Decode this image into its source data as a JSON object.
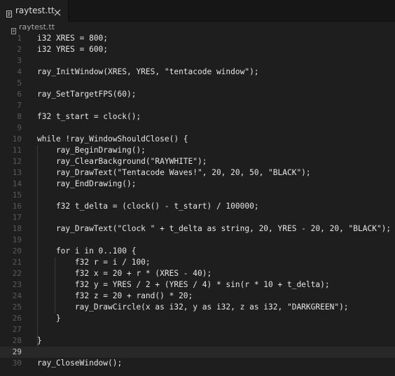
{
  "tab": {
    "label": "raytest.tt",
    "file_icon": "file-icon",
    "close_icon": "close-icon"
  },
  "breadcrumb": {
    "label": "raytest.tt",
    "icon": "file-icon"
  },
  "editor": {
    "current_line": 29,
    "lines": [
      {
        "n": "1",
        "text": "i32 XRES = 800;"
      },
      {
        "n": "2",
        "text": "i32 YRES = 600;"
      },
      {
        "n": "3",
        "text": ""
      },
      {
        "n": "4",
        "text": "ray_InitWindow(XRES, YRES, \"tentacode window\");"
      },
      {
        "n": "5",
        "text": ""
      },
      {
        "n": "6",
        "text": "ray_SetTargetFPS(60);"
      },
      {
        "n": "7",
        "text": ""
      },
      {
        "n": "8",
        "text": "f32 t_start = clock();"
      },
      {
        "n": "9",
        "text": ""
      },
      {
        "n": "10",
        "text": "while !ray_WindowShouldClose() {"
      },
      {
        "n": "11",
        "text": "    ray_BeginDrawing();"
      },
      {
        "n": "12",
        "text": "    ray_ClearBackground(\"RAYWHITE\");"
      },
      {
        "n": "13",
        "text": "    ray_DrawText(\"Tentacode Waves!\", 20, 20, 50, \"BLACK\");"
      },
      {
        "n": "14",
        "text": "    ray_EndDrawing();"
      },
      {
        "n": "15",
        "text": ""
      },
      {
        "n": "16",
        "text": "    f32 t_delta = (clock() - t_start) / 100000;"
      },
      {
        "n": "17",
        "text": ""
      },
      {
        "n": "18",
        "text": "    ray_DrawText(\"Clock \" + t_delta as string, 20, YRES - 20, 20, \"BLACK\");"
      },
      {
        "n": "19",
        "text": ""
      },
      {
        "n": "20",
        "text": "    for i in 0..100 {"
      },
      {
        "n": "21",
        "text": "        f32 r = i / 100;"
      },
      {
        "n": "22",
        "text": "        f32 x = 20 + r * (XRES - 40);"
      },
      {
        "n": "23",
        "text": "        f32 y = YRES / 2 + (YRES / 4) * sin(r * 10 + t_delta);"
      },
      {
        "n": "24",
        "text": "        f32 z = 20 + rand() * 20;"
      },
      {
        "n": "25",
        "text": "        ray_DrawCircle(x as i32, y as i32, z as i32, \"DARKGREEN\");"
      },
      {
        "n": "26",
        "text": "    }"
      },
      {
        "n": "27",
        "text": ""
      },
      {
        "n": "28",
        "text": "}"
      },
      {
        "n": "29",
        "text": ""
      },
      {
        "n": "30",
        "text": "ray_CloseWindow();"
      }
    ]
  }
}
